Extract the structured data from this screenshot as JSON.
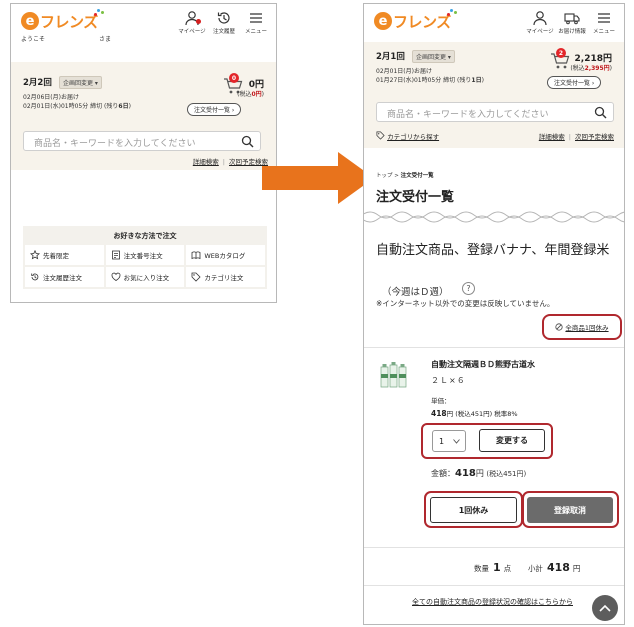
{
  "brand": {
    "logo_text": "フレンズ",
    "logo_letter": "e",
    "orange": "#f08a24"
  },
  "header": {
    "welcome": "ようこそ",
    "sama": "さま",
    "mypage": "マイページ",
    "order_history": "注文履歴",
    "menu": "メニュー",
    "delivery_info": "お届け情報"
  },
  "left": {
    "round": "2月2回",
    "plan_change": "企画回変更",
    "delivery": "02月06日(月)お届け",
    "deadline_prefix": "02月01日(水)01時05分 締切 (残り",
    "deadline_days": "6日",
    "deadline_suffix": ")",
    "cart_count": "0",
    "amount": "0円",
    "amount_tax_prefix": "(税込",
    "amount_tax_value": "0円",
    "amount_tax_suffix": ")",
    "order_list_button": "注文受付一覧",
    "search_placeholder": "商品名・キーワードを入力してください",
    "advanced_search": "詳細検索",
    "next_schedule_search": "次回予定検索",
    "methods_title": "お好きな方法で注文",
    "methods": [
      {
        "label": "先着限定",
        "icon": "star-icon"
      },
      {
        "label": "注文番号注文",
        "icon": "note-icon"
      },
      {
        "label": "WEBカタログ",
        "icon": "book-icon"
      },
      {
        "label": "注文履歴注文",
        "icon": "history-icon"
      },
      {
        "label": "お気に入り注文",
        "icon": "heart-icon"
      },
      {
        "label": "カテゴリ注文",
        "icon": "tag-icon"
      }
    ]
  },
  "right": {
    "round": "2月1回",
    "plan_change": "企画回変更",
    "delivery": "02月01日(月)お届け",
    "deadline_prefix": "01月27日(水)01時05分 締切 (残り",
    "deadline_days": "1日",
    "deadline_suffix": ")",
    "cart_count": "2",
    "amount": "2,218円",
    "amount_tax_prefix": "(税込",
    "amount_tax_value": "2,395円",
    "amount_tax_suffix": ")",
    "order_list_button": "注文受付一覧",
    "search_placeholder": "商品名・キーワードを入力してください",
    "category_search": "カテゴリから探す",
    "advanced_search": "詳細検索",
    "next_schedule_search": "次回予定検索",
    "breadcrumb_top": "トップ",
    "breadcrumb_sep": ">",
    "breadcrumb_current": "注文受付一覧",
    "page_title": "注文受付一覧",
    "section_title": "自動注文商品、登録バナナ、年間登録米",
    "week": "（今週はＤ週）",
    "help": "?",
    "notice": "※インターネット以外での変更は反映していません。",
    "skip_all": "全商品1回休み",
    "product": {
      "name": "自動注文隔週ＢＤ熊野古道水",
      "size": "２Ｌ×６",
      "unit_label": "単価：",
      "unit_price": "418",
      "unit_price_suffix": "円 (税込451円)  税率8%",
      "quantity": "1",
      "change_button": "変更する",
      "total_label": "金額：",
      "total": "418",
      "total_suffix": "円",
      "total_tax": "(税込451円)",
      "skip_button": "1回休み",
      "cancel_button": "登録取消"
    },
    "summary": {
      "qty_label": "数量",
      "qty_value": "1",
      "qty_unit": "点",
      "subtotal_label": "小計",
      "subtotal_value": "418",
      "subtotal_unit": "円"
    },
    "footer_link": "全ての自動注文商品の登録状況の確認はこちらから"
  },
  "colors": {
    "highlight": "#b0282e",
    "arrow": "#e8731c",
    "panel": "#f7f3eb",
    "badge": "#e3262a"
  }
}
